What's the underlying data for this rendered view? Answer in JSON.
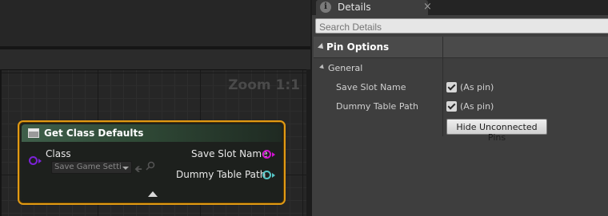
{
  "graph": {
    "zoom_label": "Zoom 1:1",
    "node": {
      "title": "Get Class Defaults",
      "input_pin_label": "Class",
      "class_value": "Save Game Setti",
      "output_pins": [
        {
          "label": "Save Slot Name",
          "color": "#d312d3"
        },
        {
          "label": "Dummy Table Path",
          "color": "#56c7c7"
        }
      ],
      "input_pin_color": "#7c22d8",
      "border_color": "#e19a14"
    }
  },
  "details": {
    "tab_label": "Details",
    "tab_close": "×",
    "search_placeholder": "Search Details",
    "category_label": "Pin Options",
    "subcategory_label": "General",
    "properties": [
      {
        "label": "Save Slot Name",
        "value": "(As pin)",
        "checked": true
      },
      {
        "label": "Dummy Table Path",
        "value": "(As pin)",
        "checked": true
      }
    ],
    "hide_button_label": "Hide Unconnected Pins"
  }
}
